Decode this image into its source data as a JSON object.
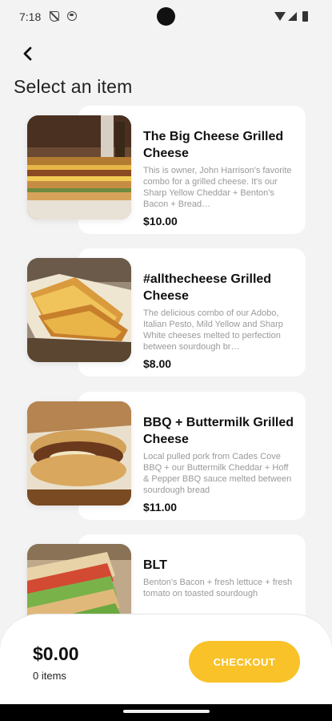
{
  "status_bar": {
    "time": "7:18"
  },
  "header": {
    "title": "Select an item"
  },
  "items": [
    {
      "name": "The Big Cheese Grilled Cheese",
      "description": "This is owner, John Harrison's favorite combo for a grilled cheese. It's our Sharp Yellow Cheddar + Benton's Bacon + Bread…",
      "price": "$10.00"
    },
    {
      "name": "#allthecheese Grilled Cheese",
      "description": "The delicious combo of our Adobo, Italian Pesto, Mild Yellow and Sharp White cheeses melted to perfection between sourdough br…",
      "price": "$8.00"
    },
    {
      "name": "BBQ + Buttermilk Grilled Cheese",
      "description": "Local pulled pork from Cades Cove BBQ + our Buttermilk Cheddar + Hoff & Pepper BBQ sauce melted between sourdough bread",
      "price": "$11.00"
    },
    {
      "name": "BLT",
      "description": "Benton's Bacon + fresh lettuce + fresh tomato on toasted sourdough",
      "price": ""
    }
  ],
  "cart": {
    "total": "$0.00",
    "count": "0 items",
    "checkout_label": "CHECKOUT"
  },
  "colors": {
    "accent": "#f8c228",
    "background": "#f3f3f3",
    "card": "#ffffff",
    "muted_text": "#9a9a9a"
  }
}
